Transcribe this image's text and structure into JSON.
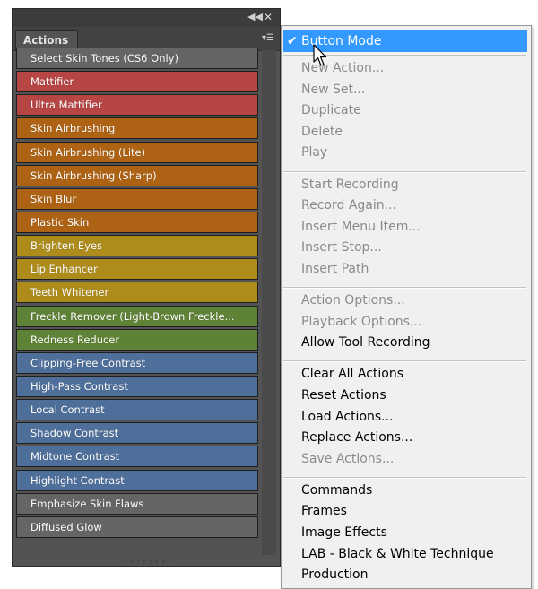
{
  "panel": {
    "tab_label": "Actions",
    "window_controls": [
      "collapse-icon",
      "close-icon"
    ],
    "menu_icon": "panel-menu-icon",
    "actions": [
      {
        "label": "Select Skin Tones (CS6 Only)",
        "color": "#656565"
      },
      {
        "label": "Mattifier",
        "color": "#b64544"
      },
      {
        "label": "Ultra Mattifier",
        "color": "#b64544"
      },
      {
        "label": "Skin Airbrushing",
        "color": "#ad6214"
      },
      {
        "label": "Skin Airbrushing (Lite)",
        "color": "#ad6214"
      },
      {
        "label": "Skin Airbrushing (Sharp)",
        "color": "#ad6214"
      },
      {
        "label": "Skin Blur",
        "color": "#ad6214"
      },
      {
        "label": "Plastic Skin",
        "color": "#ad6214"
      },
      {
        "label": "Brighten Eyes",
        "color": "#ad8c1b"
      },
      {
        "label": "Lip Enhancer",
        "color": "#ad8c1b"
      },
      {
        "label": "Teeth Whitener",
        "color": "#ad8c1b"
      },
      {
        "label": "Freckle Remover (Light-Brown Freckle...",
        "color": "#5e8236"
      },
      {
        "label": "Redness Reducer",
        "color": "#5e8236"
      },
      {
        "label": "Clipping-Free Contrast",
        "color": "#4f6f9b"
      },
      {
        "label": "High-Pass Contrast",
        "color": "#4f6f9b"
      },
      {
        "label": "Local Contrast",
        "color": "#4f6f9b"
      },
      {
        "label": "Shadow Contrast",
        "color": "#4f6f9b"
      },
      {
        "label": "Midtone Contrast",
        "color": "#4f6f9b"
      },
      {
        "label": "Highlight Contrast",
        "color": "#4f6f9b"
      },
      {
        "label": "Emphasize Skin Flaws",
        "color": "#656565"
      },
      {
        "label": "Diffused Glow",
        "color": "#656565"
      }
    ]
  },
  "menu": {
    "checked_item": "Button Mode",
    "groups": [
      [
        {
          "label": "New Action...",
          "enabled": false
        },
        {
          "label": "New Set...",
          "enabled": false
        },
        {
          "label": "Duplicate",
          "enabled": false
        },
        {
          "label": "Delete",
          "enabled": false
        },
        {
          "label": "Play",
          "enabled": false
        }
      ],
      [
        {
          "label": "Start Recording",
          "enabled": false
        },
        {
          "label": "Record Again...",
          "enabled": false
        },
        {
          "label": "Insert Menu Item...",
          "enabled": false
        },
        {
          "label": "Insert Stop...",
          "enabled": false
        },
        {
          "label": "Insert Path",
          "enabled": false
        }
      ],
      [
        {
          "label": "Action Options...",
          "enabled": false
        },
        {
          "label": "Playback Options...",
          "enabled": false
        },
        {
          "label": "Allow Tool Recording",
          "enabled": true
        }
      ],
      [
        {
          "label": "Clear All Actions",
          "enabled": true
        },
        {
          "label": "Reset Actions",
          "enabled": true
        },
        {
          "label": "Load Actions...",
          "enabled": true
        },
        {
          "label": "Replace Actions...",
          "enabled": true
        },
        {
          "label": "Save Actions...",
          "enabled": false
        }
      ],
      [
        {
          "label": "Commands",
          "enabled": true
        },
        {
          "label": "Frames",
          "enabled": true
        },
        {
          "label": "Image Effects",
          "enabled": true
        },
        {
          "label": "LAB - Black & White Technique",
          "enabled": true
        },
        {
          "label": "Production",
          "enabled": true
        }
      ]
    ]
  },
  "icons": {
    "checkmark": "checkmark-icon",
    "cursor": "mouse-pointer-icon"
  }
}
